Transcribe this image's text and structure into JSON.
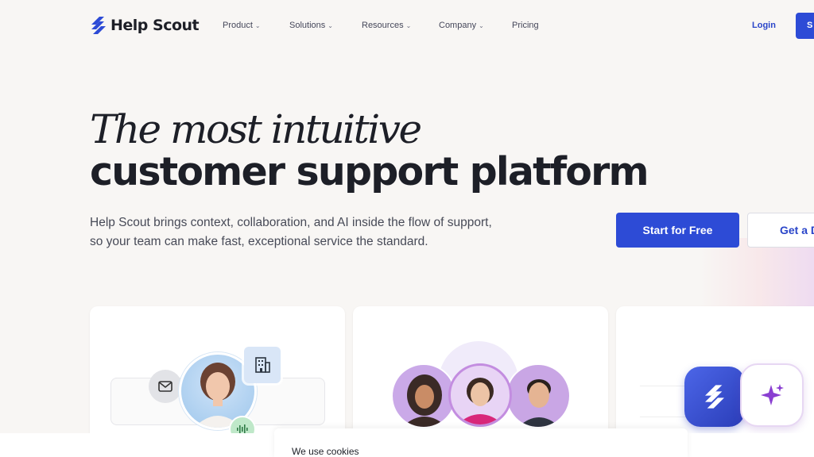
{
  "brand": {
    "name": "Help Scout",
    "accent": "#2d4bd6"
  },
  "nav": {
    "items": [
      {
        "label": "Product",
        "has_dropdown": true
      },
      {
        "label": "Solutions",
        "has_dropdown": true
      },
      {
        "label": "Resources",
        "has_dropdown": true
      },
      {
        "label": "Company",
        "has_dropdown": true
      },
      {
        "label": "Pricing",
        "has_dropdown": false
      }
    ],
    "login_label": "Login",
    "signup_label": "S"
  },
  "hero": {
    "line1": "The most intuitive",
    "line2": "customer support platform",
    "subtitle": "Help Scout brings context, collaboration, and AI inside the flow of support, so your team can make fast, exceptional service the standard.",
    "cta_primary": "Start for Free",
    "cta_secondary": "Get a D"
  },
  "cards": {
    "icons": {
      "mail": "mail-icon",
      "building": "building-icon",
      "audio": "audio-wave-icon",
      "sparkle": "sparkle-icon",
      "logo": "help-scout-logo-icon"
    }
  },
  "cookie": {
    "title": "We use cookies"
  }
}
